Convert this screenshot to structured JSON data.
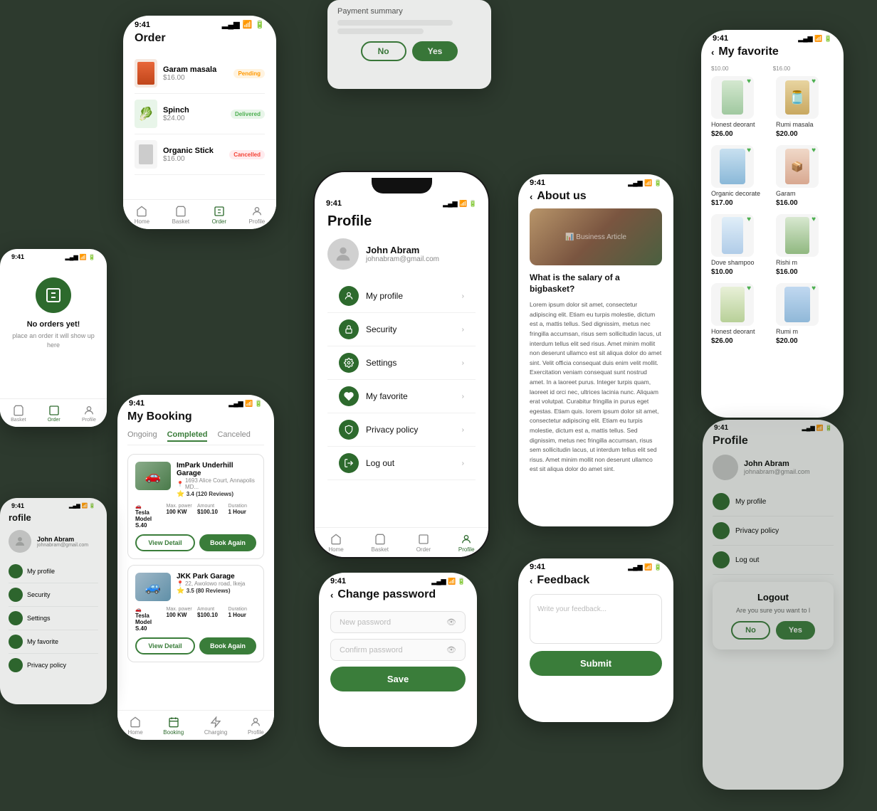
{
  "bg_color": "#2d3a2e",
  "phone_profile_main": {
    "time": "9:41",
    "title": "Profile",
    "user_name": "John Abram",
    "user_email": "johnabram@gmail.com",
    "menu_items": [
      {
        "label": "My profile",
        "icon": "person"
      },
      {
        "label": "Security",
        "icon": "lock"
      },
      {
        "label": "Settings",
        "icon": "gear"
      },
      {
        "label": "My favorite",
        "icon": "heart"
      },
      {
        "label": "Privacy policy",
        "icon": "shield"
      },
      {
        "label": "Log out",
        "icon": "logout"
      }
    ],
    "nav": [
      "Home",
      "Basket",
      "Order",
      "Profile"
    ]
  },
  "phone_order": {
    "time": "9:41",
    "title": "Order",
    "items": [
      {
        "name": "Garam masala",
        "price": "$16.00",
        "status": "Pending",
        "color": "orange"
      },
      {
        "name": "Spinch",
        "price": "$24.00",
        "status": "Delivered",
        "color": "green"
      },
      {
        "name": "Organic Stick",
        "price": "$16.00",
        "status": "Cancelled",
        "color": "red"
      }
    ]
  },
  "phone_booking": {
    "time": "9:41",
    "title": "My Booking",
    "tabs": [
      "Ongoing",
      "Completed",
      "Canceled"
    ],
    "active_tab": "Completed",
    "bookings": [
      {
        "garage": "ImPark Underhill Garage",
        "address": "1693 Alice Court, Annapolis MD...",
        "rating": "3.4",
        "reviews": "120 Reviews",
        "model": "Tesla Model S 40",
        "power": "100 KW",
        "amount": "$100.10",
        "duration": "1 Hour"
      },
      {
        "garage": "JKK Park Garage",
        "address": "22, Awolowo road, Ikeja",
        "rating": "3.5",
        "reviews": "80 Reviews",
        "model": "Tesla Model S 40",
        "power": "100 KW",
        "amount": "$100.10",
        "duration": "1 Hour"
      }
    ],
    "view_detail_label": "View Detail",
    "book_again_label": "Book Again"
  },
  "phone_about": {
    "time": "9:41",
    "title": "About us",
    "article_title": "What is the salary of a bigbasket?",
    "article_body": "Lorem ipsum dolor sit amet, consectetur adipiscing elit. Etiam eu turpis molestie, dictum est a, mattis tellus. Sed dignissim, metus nec fringilla accumsan, risus sem sollicitudin lacus, ut interdum tellus elit sed risus.\n\nAmet minim mollit non deserunt ullamco est sit aliqua dolor do amet sint. Velit officia consequat duis enim velit mollit. Exercitation veniam consequat sunt nostrud amet.\n\nIn a laoreet purus. Integer turpis quam, laoreet id orci nec, ultrices lacinia nunc. Aliquam erat volutpat. Curabitur fringilla in purus eget egestas. Etiam quis.\n\nIorem ipsum dolor sit amet, consectetur adipiscing elit. Etiam eu turpis molestie, dictum est a, mattis tellus. Sed dignissim, metus nec fringilla accumsan, risus sem sollicitudin lacus, ut interdum tellus elit sed risus.\n\nAmet minim mollit non deserunt ullamco est sit aliqua dolor do amet sint."
  },
  "phone_feedback": {
    "time": "9:41",
    "title": "Feedback",
    "placeholder": "Write your feedback...",
    "submit_label": "Submit"
  },
  "phone_favorite": {
    "time": "9:41",
    "title": "My favorite",
    "products": [
      {
        "name": "Honest deorant",
        "price": "$26.00"
      },
      {
        "name": "Rumi masala",
        "price": "$20.00"
      },
      {
        "name": "Organic decorate",
        "price": "$17.00"
      },
      {
        "name": "Garam",
        "price": "$16.00"
      },
      {
        "name": "Dove shampoo",
        "price": "$10.00"
      },
      {
        "name": "Rishi m",
        "price": "$16.00"
      },
      {
        "name": "Honest deorant",
        "price": "$26.00"
      },
      {
        "name": "Rumi m",
        "price": "$20.00"
      }
    ]
  },
  "phone_password": {
    "time": "9:41",
    "title": "Change password",
    "new_password_placeholder": "New password",
    "confirm_password_placeholder": "Confirm password",
    "save_label": "Save"
  },
  "phone_dialog": {
    "title": "Payment summary",
    "no_label": "No",
    "yes_label": "Yes"
  },
  "phone_logout_dialog": {
    "title": "Logout",
    "message": "Are you sure you want to l",
    "no_label": "No"
  },
  "phone_no_orders": {
    "message": "No orders yet!",
    "sub_message": "place an order it will show up here"
  },
  "top_prices": {
    "product1": {
      "name": "Honest deorant",
      "price": "$26.00"
    },
    "product2": {
      "name": "Rumi masala",
      "price": "$20.00"
    }
  }
}
